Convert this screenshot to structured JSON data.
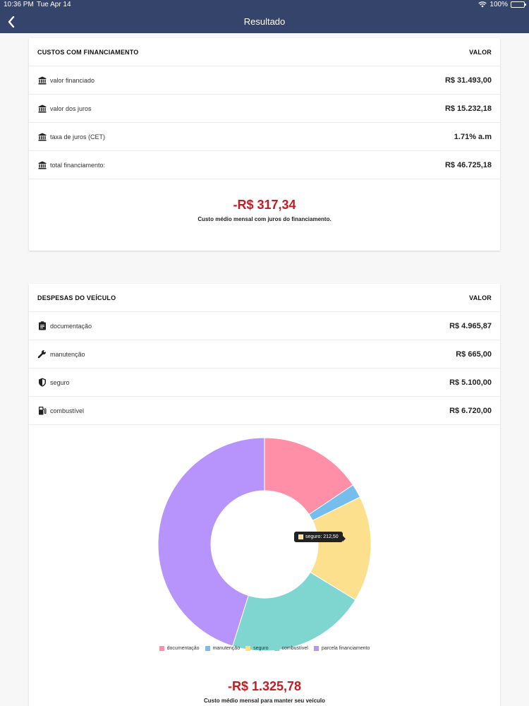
{
  "status": {
    "time": "10:36 PM",
    "date": "Tue Apr 14",
    "battery": "100%"
  },
  "nav": {
    "title": "Resultado"
  },
  "financing": {
    "header": {
      "label": "CUSTOS COM FINANCIAMENTO",
      "value": "VALOR"
    },
    "rows": [
      {
        "label": "valor financiado",
        "value": "R$ 31.493,00",
        "icon": "bank-icon"
      },
      {
        "label": "valor dos juros",
        "value": "R$ 15.232,18",
        "icon": "bank-icon"
      },
      {
        "label": "taxa de juros (CET)",
        "value": "1.71% a.m",
        "icon": "bank-icon"
      },
      {
        "label": "total financiamento:",
        "value": "R$ 46.725,18",
        "icon": "bank-icon"
      }
    ],
    "summary": {
      "amount": "-R$ 317,34",
      "caption": "Custo médio mensal com juros do financiamento."
    }
  },
  "expenses": {
    "header": {
      "label": "DESPESAS DO VEÍCULO",
      "value": "VALOR"
    },
    "rows": [
      {
        "label": "documentação",
        "value": "R$ 4.965,87",
        "icon": "clipboard-icon"
      },
      {
        "label": "manutenção",
        "value": "R$ 665,00",
        "icon": "wrench-icon"
      },
      {
        "label": "seguro",
        "value": "R$ 5.100,00",
        "icon": "shield-icon"
      },
      {
        "label": "combustível",
        "value": "R$ 6.720,00",
        "icon": "fuel-icon"
      }
    ],
    "summary": {
      "amount": "-R$ 1.325,78",
      "caption": "Custo médio mensal para manter seu veículo"
    }
  },
  "chart_data": {
    "type": "pie",
    "donut": true,
    "categories": [
      "documentação",
      "manutenção",
      "seguro",
      "combustível",
      "parcela financiamento"
    ],
    "values": [
      206.91,
      27.71,
      212.5,
      280.0,
      598.66
    ],
    "colors": [
      "#ff8fa6",
      "#75bdec",
      "#fde08e",
      "#7fd6d1",
      "#b794fc"
    ],
    "tooltip": {
      "text": "seguro: 212,50",
      "color": "#fde08e"
    }
  }
}
